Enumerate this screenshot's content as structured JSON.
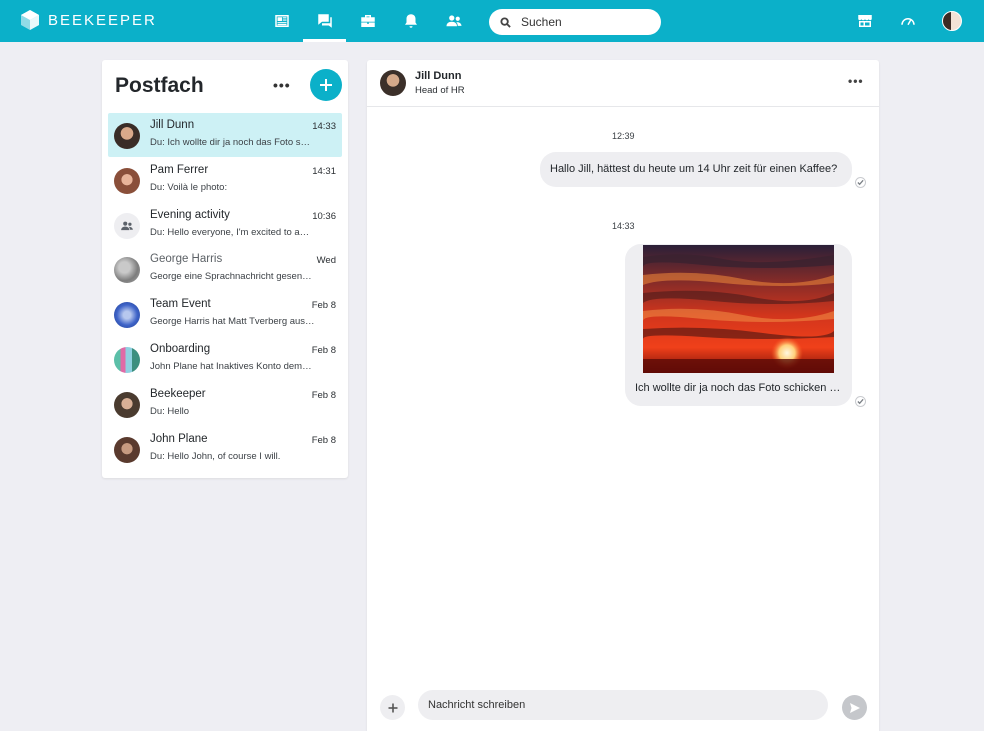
{
  "app": {
    "brand": "BEEKEEPER"
  },
  "search": {
    "placeholder": "Suchen"
  },
  "nav": {
    "items": [
      {
        "icon": "news-feed-icon"
      },
      {
        "icon": "chats-icon",
        "active": true
      },
      {
        "icon": "tools-icon"
      },
      {
        "icon": "bell-icon"
      },
      {
        "icon": "people-icon"
      }
    ],
    "right_icons": [
      "shop-icon",
      "dashboard-icon",
      "user-avatar"
    ]
  },
  "inbox": {
    "title": "Postfach",
    "conversations": [
      {
        "name": "Jill Dunn",
        "time": "14:33",
        "preview": "Du: Ich wollte dir ja noch das Foto s…",
        "active": true
      },
      {
        "name": "Pam Ferrer",
        "time": "14:31",
        "preview": "Du: Voilà le photo:"
      },
      {
        "name": "Evening activity",
        "time": "10:36",
        "preview": "Du: Hello everyone, I'm excited to a…"
      },
      {
        "name": "George Harris",
        "time": "Wed",
        "preview": "George eine Sprachnachricht gesen…"
      },
      {
        "name": "Team Event",
        "time": "Feb 8",
        "preview": "George Harris hat Matt Tverberg aus…"
      },
      {
        "name": "Onboarding",
        "time": "Feb 8",
        "preview": "John Plane hat Inaktives Konto dem…"
      },
      {
        "name": "Beekeeper",
        "time": "Feb 8",
        "preview": "Du: Hello"
      },
      {
        "name": "John Plane",
        "time": "Feb 8",
        "preview": "Du: Hello John, of course I will."
      }
    ]
  },
  "chat": {
    "name": "Jill Dunn",
    "role": "Head of HR",
    "messages": [
      {
        "timestamp": "12:39",
        "text": "Hallo Jill, hättest du heute um 14 Uhr zeit für einen Kaffee?"
      },
      {
        "timestamp": "14:33",
        "text": "Ich wollte dir ja noch das Foto schicken …",
        "has_photo": true
      }
    ],
    "composer_placeholder": "Nachricht schreiben"
  },
  "colors": {
    "brand": "#0bb0c9",
    "active_row": "#cdf1f5",
    "bubble": "#eeeef1",
    "background": "#eeeef3"
  }
}
